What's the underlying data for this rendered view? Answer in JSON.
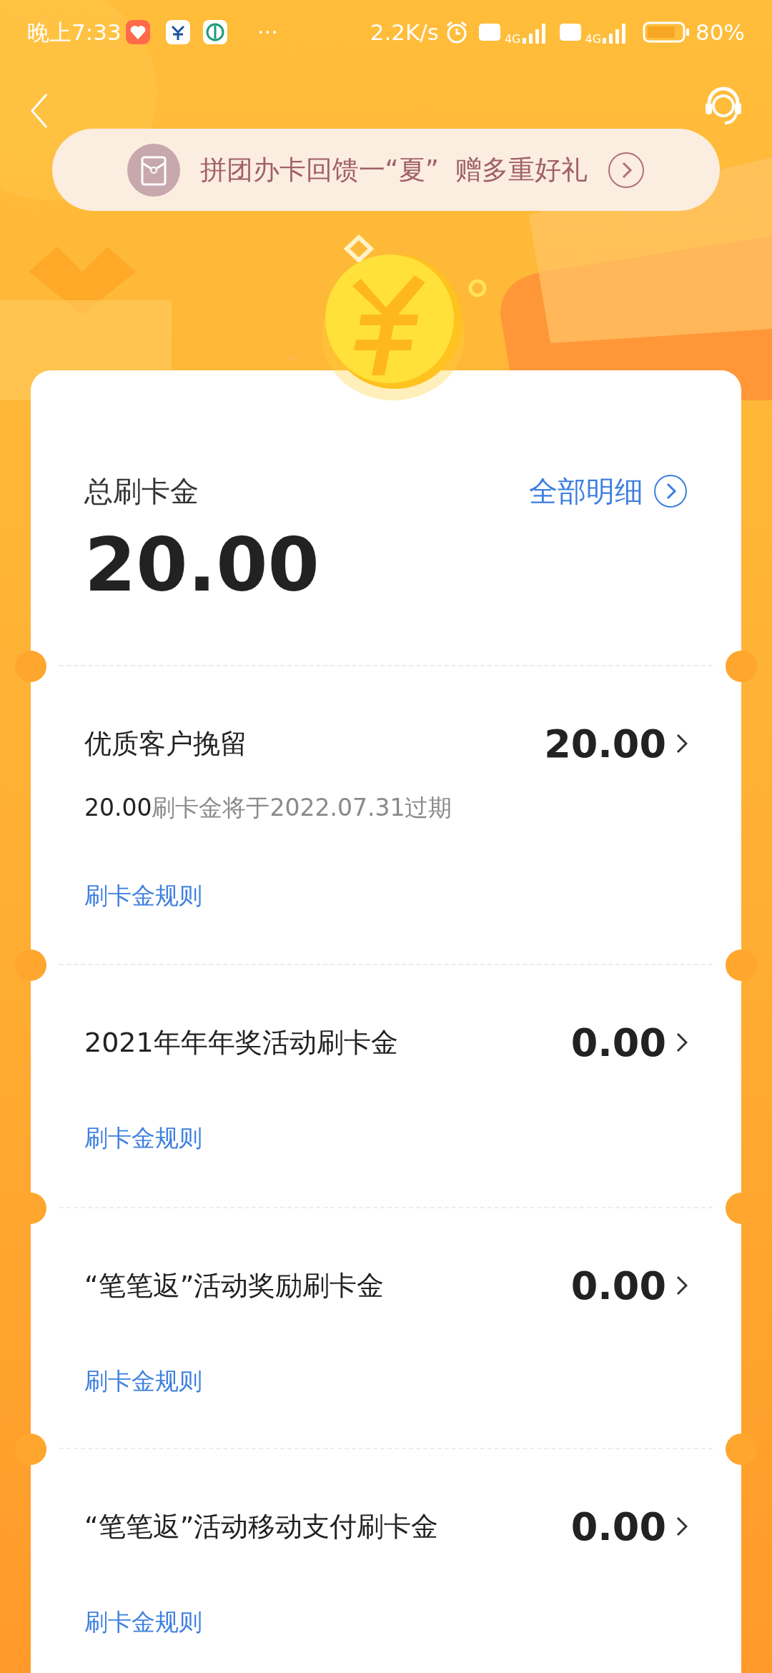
{
  "status_bar": {
    "time": "晚上7:33",
    "more": "···",
    "net_speed": "2.2K/s",
    "networks": [
      {
        "label": "4G"
      },
      {
        "label": "4G"
      }
    ],
    "battery": "80%"
  },
  "banner": {
    "text": "拼团办卡回馈一“夏”  赠多重好礼"
  },
  "summary": {
    "title": "总刷卡金",
    "link": "全部明细",
    "amount": "20.00"
  },
  "items": [
    {
      "title": "优质客户挽留",
      "amount": "20.00",
      "expiry_amount": "20.00",
      "expiry_text": "刷卡金将于2022.07.31过期",
      "rules": "刷卡金规则"
    },
    {
      "title": "2021年年年奖活动刷卡金",
      "amount": "0.00",
      "rules": "刷卡金规则"
    },
    {
      "title": "“笔笔返”活动奖励刷卡金",
      "amount": "0.00",
      "rules": "刷卡金规则"
    },
    {
      "title": "“笔笔返”活动移动支付刷卡金",
      "amount": "0.00",
      "rules": "刷卡金规则"
    }
  ]
}
